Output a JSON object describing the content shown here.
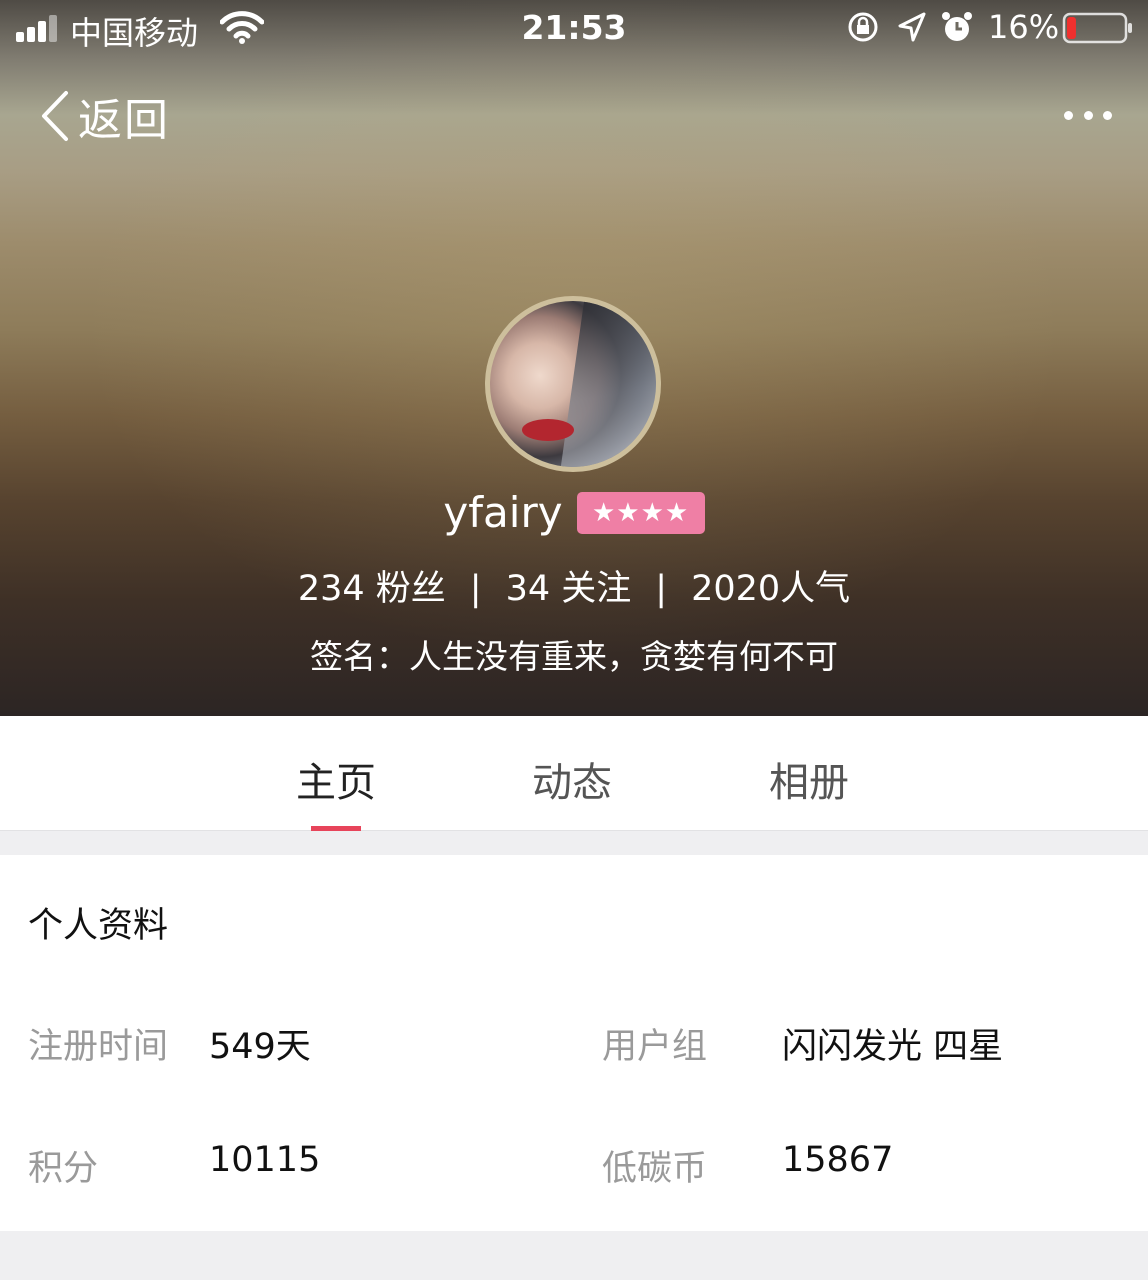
{
  "status_bar": {
    "carrier": "中国移动",
    "time": "21:53",
    "battery_percent": "16%",
    "battery_level": 0.16,
    "icons": [
      "signal-icon",
      "wifi-icon",
      "orientation-lock-icon",
      "location-icon",
      "alarm-icon",
      "battery-icon"
    ]
  },
  "nav": {
    "back_label": "返回"
  },
  "profile": {
    "username": "yfairy",
    "badge_stars": "★★★★",
    "fans": "234 粉丝",
    "following": "34 关注",
    "popularity": "2020人气",
    "separator": "|",
    "signature": "签名：人生没有重来，贪婪有何不可"
  },
  "tabs": [
    {
      "label": "主页",
      "active": true
    },
    {
      "label": "动态",
      "active": false
    },
    {
      "label": "相册",
      "active": false
    }
  ],
  "info": {
    "title": "个人资料",
    "fields": [
      {
        "label": "注册时间",
        "value": "549天"
      },
      {
        "label": "用户组",
        "value": "闪闪发光 四星"
      },
      {
        "label": "积分",
        "value": "10115"
      },
      {
        "label": "低碳币",
        "value": "15867"
      }
    ]
  },
  "colors": {
    "accent": "#e7445a",
    "badge": "#ef7fa5",
    "battery_low": "#f0302e"
  }
}
